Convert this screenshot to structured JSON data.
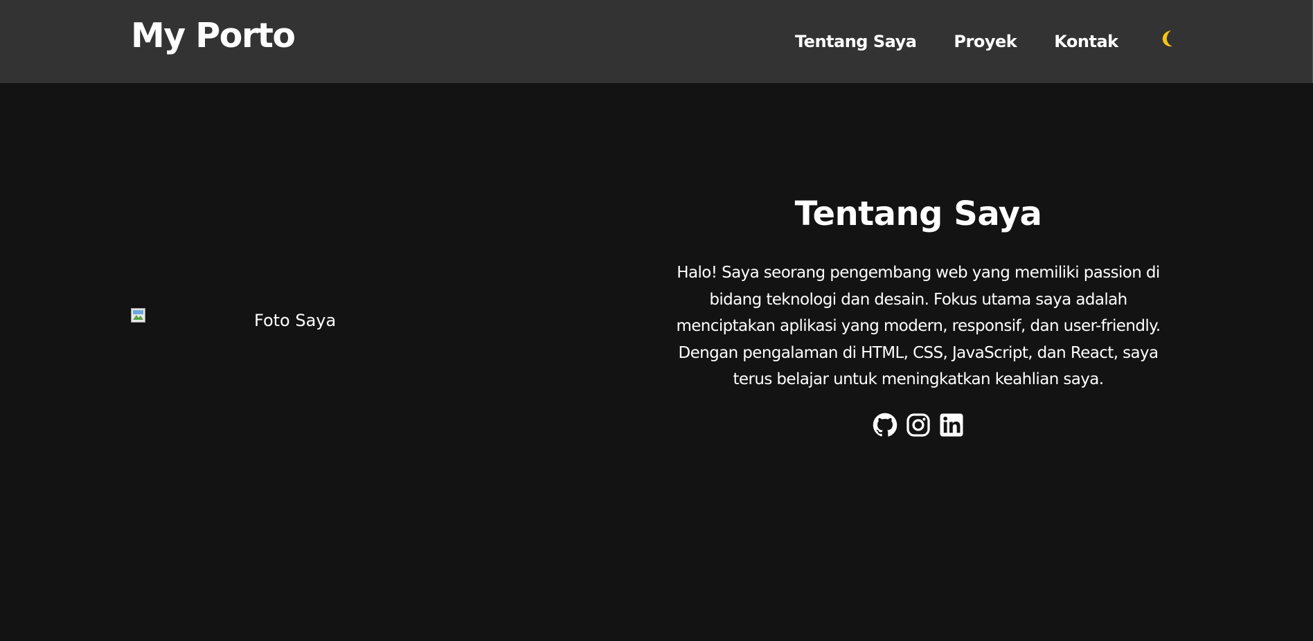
{
  "nav": {
    "brand": "My Porto",
    "links": [
      {
        "label": "Tentang Saya"
      },
      {
        "label": "Proyek"
      },
      {
        "label": "Kontak"
      }
    ],
    "theme_toggle_icon": "moon-icon"
  },
  "hero": {
    "photo_alt": "Foto Saya",
    "photo_icon": "broken-image-icon",
    "title": "Tentang Saya",
    "description": "Halo! Saya seorang pengembang web yang memiliki passion di bidang teknologi dan desain. Fokus utama saya adalah menciptakan aplikasi yang modern, responsif, dan user-friendly. Dengan pengalaman di HTML, CSS, JavaScript, dan React, saya terus belajar untuk meningkatkan keahlian saya.",
    "socials": [
      {
        "icon": "github-icon"
      },
      {
        "icon": "instagram-icon"
      },
      {
        "icon": "linkedin-icon"
      }
    ]
  },
  "colors": {
    "background": "#131313",
    "navbar": "#333333",
    "text": "#ffffff",
    "moon": "#f5c518"
  }
}
